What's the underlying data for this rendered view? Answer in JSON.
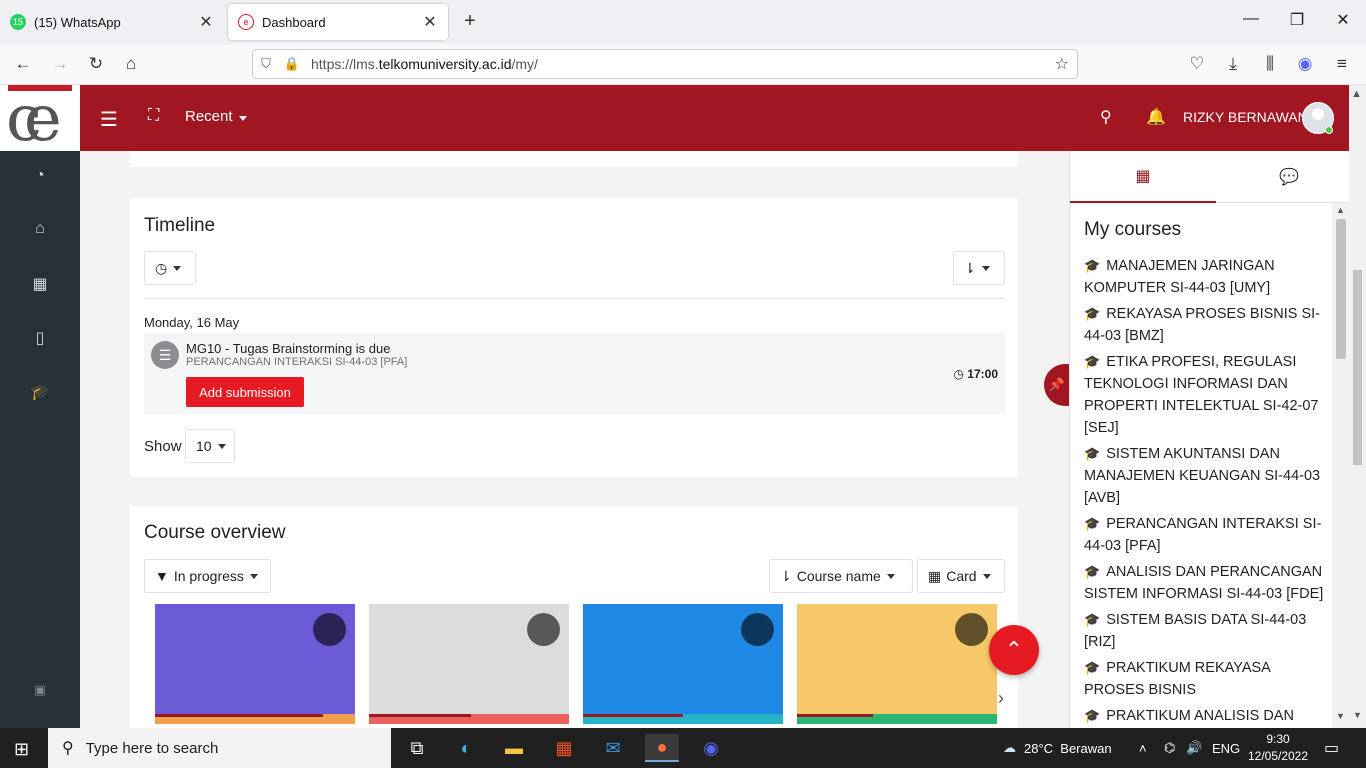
{
  "browser": {
    "tabs": [
      {
        "title": "(15) WhatsApp",
        "badge": "15",
        "color": "#25d366"
      },
      {
        "title": "Dashboard"
      }
    ],
    "url_prefix": "https://lms.",
    "url_domain": "telkomuniversity.ac.id",
    "url_path": "/my/"
  },
  "header": {
    "recent_label": "Recent",
    "user_name": "RIZKY BERNAWAN",
    "brand_color": "#a01722"
  },
  "timeline": {
    "title": "Timeline",
    "date": "Monday, 16 May",
    "event": {
      "name": "MG10 - Tugas Brainstorming is due",
      "course": "PERANCANGAN INTERAKSI SI-44-03 [PFA]",
      "action": "Add submission",
      "time": "17:00"
    },
    "show_label": "Show",
    "show_value": "10"
  },
  "overview": {
    "title": "Course overview",
    "filter_label": "In progress",
    "sort_label": "Course name",
    "view_label": "Card",
    "cards": [
      {
        "bg": "#6b5bd6",
        "foot": "#f0a04b",
        "progress": 0.84
      },
      {
        "bg": "#dcdcdc",
        "foot": "#e9605e",
        "progress": 0.51
      },
      {
        "bg": "#1f88e5",
        "foot": "#23b5c5",
        "progress": 0.5
      },
      {
        "bg": "#f6c868",
        "foot": "#2bb673",
        "progress": 0.38
      }
    ]
  },
  "drawer": {
    "title": "My courses",
    "courses": [
      "MANAJEMEN JARINGAN KOMPUTER SI-44-03 [UMY]",
      "REKAYASA PROSES BISNIS SI-44-03 [BMZ]",
      "ETIKA PROFESI, REGULASI TEKNOLOGI INFORMASI DAN PROPERTI INTELEKTUAL SI-42-07 [SEJ]",
      "SISTEM AKUNTANSI DAN MANAJEMEN KEUANGAN SI-44-03 [AVB]",
      "PERANCANGAN INTERAKSI SI-44-03 [PFA]",
      "ANALISIS DAN PERANCANGAN SISTEM INFORMASI SI-44-03 [FDE]",
      "SISTEM BASIS DATA SI-44-03 [RIZ]",
      "PRAKTIKUM REKAYASA PROSES BISNIS",
      "PRAKTIKUM ANALISIS DAN"
    ]
  },
  "taskbar": {
    "search_placeholder": "Type here to search",
    "weather": "28°C  Berawan",
    "lang": "ENG",
    "time": "9:30",
    "date": "12/05/2022"
  }
}
